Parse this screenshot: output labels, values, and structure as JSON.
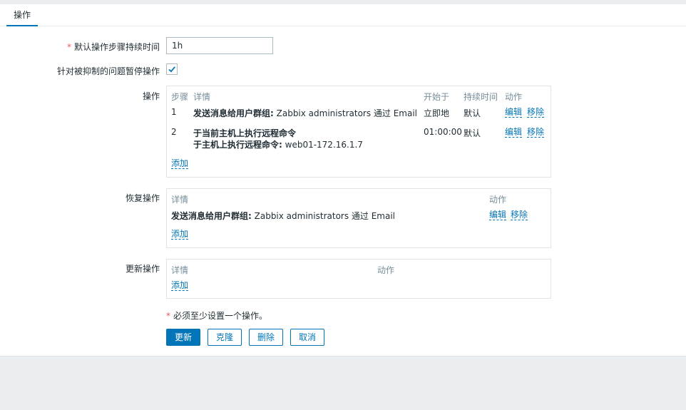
{
  "tabs": [
    {
      "label": "操作"
    }
  ],
  "form": {
    "duration_label": "默认操作步骤持续时间",
    "duration_value": "1h",
    "pause_label": "针对被抑制的问题暂停操作",
    "pause_checked": true
  },
  "operations": {
    "label": "操作",
    "headers": {
      "step": "步骤",
      "details": "详情",
      "start": "开始于",
      "duration": "持续时间",
      "action": "动作"
    },
    "rows": [
      {
        "step": "1",
        "detail_bold": "发送消息给用户群组:",
        "detail_text": " Zabbix administrators 通过 Email",
        "detail2_bold": "",
        "detail2_text": "",
        "start": "立即地",
        "duration": "默认",
        "edit": "编辑",
        "remove": "移除"
      },
      {
        "step": "2",
        "detail_bold": "于当前主机上执行远程命令",
        "detail_text": "",
        "detail2_bold": "于主机上执行远程命令:",
        "detail2_text": " web01-172.16.1.7",
        "start": "01:00:00",
        "duration": "默认",
        "edit": "编辑",
        "remove": "移除"
      }
    ],
    "add": "添加"
  },
  "recovery": {
    "label": "恢复操作",
    "headers": {
      "details": "详情",
      "action": "动作"
    },
    "rows": [
      {
        "detail_bold": "发送消息给用户群组:",
        "detail_text": " Zabbix administrators 通过 Email",
        "edit": "编辑",
        "remove": "移除"
      }
    ],
    "add": "添加"
  },
  "update": {
    "label": "更新操作",
    "headers": {
      "details": "详情",
      "action": "动作"
    },
    "add": "添加"
  },
  "note": "必须至少设置一个操作。",
  "buttons": {
    "update": "更新",
    "clone": "克隆",
    "delete": "删除",
    "cancel": "取消"
  },
  "colors": {
    "accent": "#0275b8",
    "required": "#e45959",
    "header_text": "#768d99",
    "background": "#ebeef0"
  }
}
